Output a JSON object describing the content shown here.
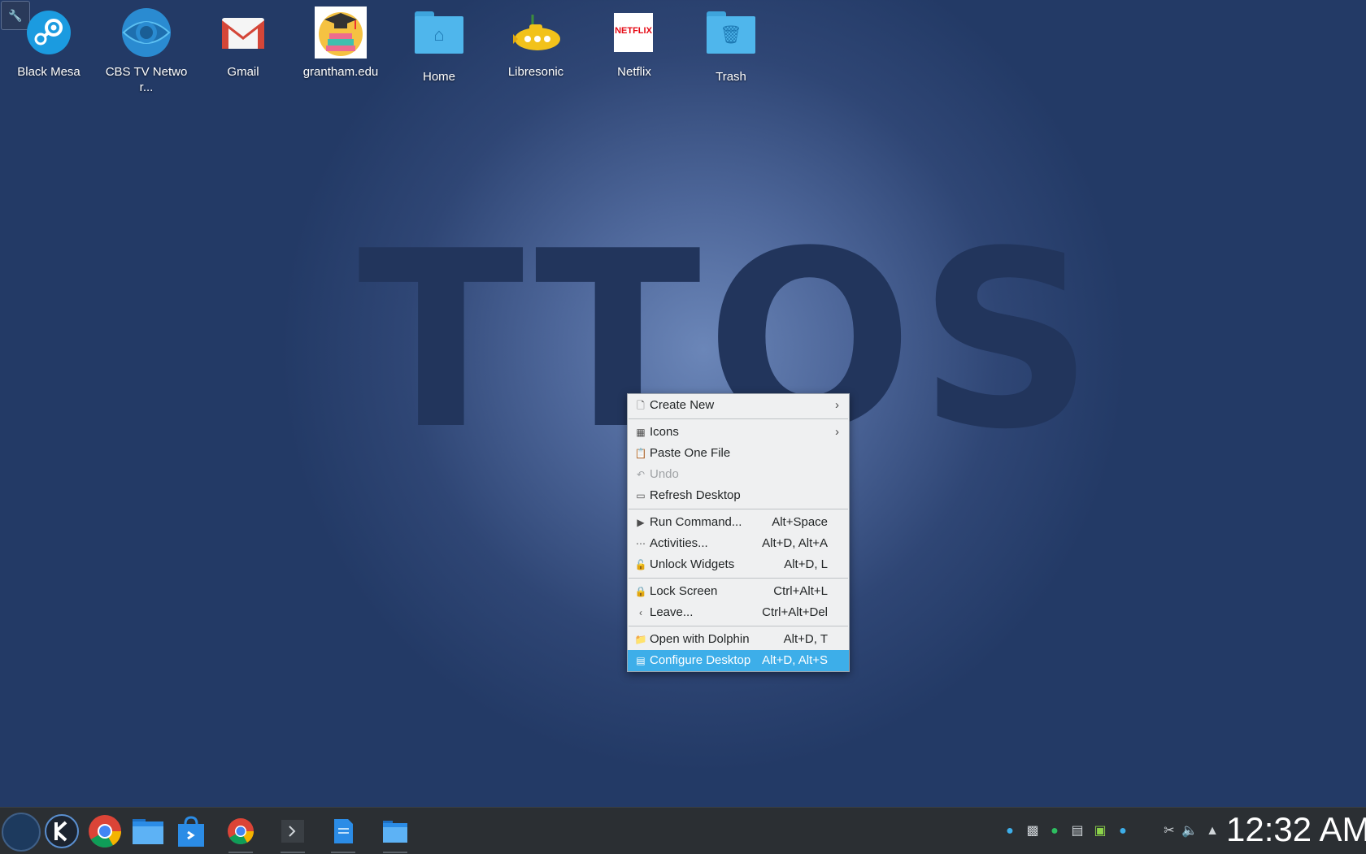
{
  "wallpaper": {
    "text": "TTOS"
  },
  "desktop": {
    "icons": [
      {
        "label": "Black Mesa",
        "icon": "steam-icon"
      },
      {
        "label": "CBS TV Networ...",
        "icon": "cbs-icon"
      },
      {
        "label": "Gmail",
        "icon": "gmail-icon"
      },
      {
        "label": "grantham.edu",
        "icon": "graduation-icon"
      },
      {
        "label": "Home",
        "icon": "home-folder-icon"
      },
      {
        "label": "Libresonic",
        "icon": "submarine-icon"
      },
      {
        "label": "Netflix",
        "icon": "netflix-icon",
        "logo_text": "NETFLIX"
      },
      {
        "label": "Trash",
        "icon": "trash-folder-icon"
      }
    ]
  },
  "context_menu": {
    "items": [
      {
        "label": "Create New",
        "icon": "new-document-icon",
        "shortcut": "",
        "submenu": true
      },
      {
        "label": "Icons",
        "icon": "icons-grid-icon",
        "shortcut": "",
        "submenu": true
      },
      {
        "label": "Paste One File",
        "icon": "clipboard-icon",
        "shortcut": ""
      },
      {
        "label": "Undo",
        "icon": "undo-icon",
        "shortcut": "",
        "disabled": true
      },
      {
        "label": "Refresh Desktop",
        "icon": "refresh-desktop-icon",
        "shortcut": ""
      },
      {
        "label": "Run Command...",
        "icon": "run-command-icon",
        "shortcut": "Alt+Space"
      },
      {
        "label": "Activities...",
        "icon": "activities-icon",
        "shortcut": "Alt+D, Alt+A"
      },
      {
        "label": "Unlock Widgets",
        "icon": "unlock-icon",
        "shortcut": "Alt+D, L"
      },
      {
        "label": "Lock Screen",
        "icon": "lock-icon",
        "shortcut": "Ctrl+Alt+L"
      },
      {
        "label": "Leave...",
        "icon": "leave-icon",
        "shortcut": "Ctrl+Alt+Del"
      },
      {
        "label": "Open with Dolphin",
        "icon": "dolphin-folder-icon",
        "shortcut": "Alt+D, T"
      },
      {
        "label": "Configure Desktop",
        "icon": "configure-desktop-icon",
        "shortcut": "Alt+D, Alt+S",
        "selected": true
      }
    ],
    "submenu_arrow": "›"
  },
  "taskbar": {
    "clock": "12:32 AM",
    "apps": [
      "application-launcher",
      "kdenlive",
      "chrome",
      "file-manager",
      "discover",
      "chrome-window",
      "terminal",
      "text-editor",
      "dolphin"
    ],
    "tray": [
      "accessibility",
      "usb-device",
      "evernote",
      "drive",
      "network",
      "accessibility-2",
      "clipboard",
      "volume",
      "expand-tray"
    ]
  },
  "colors": {
    "accent": "#3daee9",
    "panel": "#2b2f33",
    "menu_bg": "#eff0f1"
  }
}
